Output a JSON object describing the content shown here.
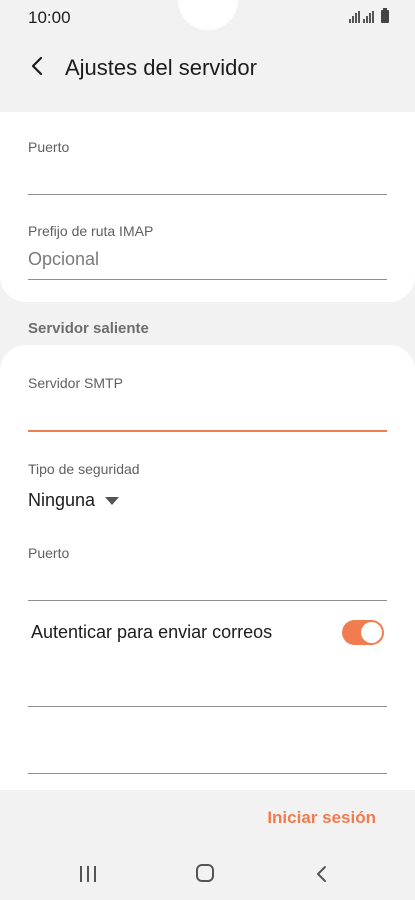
{
  "status_bar": {
    "time": "10:00"
  },
  "header": {
    "title": "Ajustes del servidor"
  },
  "incoming": {
    "port_label": "Puerto",
    "port_value": "",
    "imap_prefix_label": "Prefijo de ruta IMAP",
    "imap_prefix_placeholder": "Opcional"
  },
  "outgoing": {
    "section_title": "Servidor saliente",
    "smtp_label": "Servidor SMTP",
    "smtp_value": "",
    "security_label": "Tipo de seguridad",
    "security_value": "Ninguna",
    "port_label": "Puerto",
    "port_value": "",
    "auth_label": "Autenticar para enviar correos",
    "auth_enabled": true,
    "username_value": "",
    "password_value": ""
  },
  "footer": {
    "login_label": "Iniciar sesión"
  },
  "colors": {
    "accent": "#f07c4f",
    "background": "#f2f2f2",
    "card": "#ffffff"
  },
  "icons": {
    "back": "chevron-left-icon",
    "nav_recent": "recent-apps-icon",
    "nav_home": "home-icon",
    "nav_back": "back-icon"
  }
}
